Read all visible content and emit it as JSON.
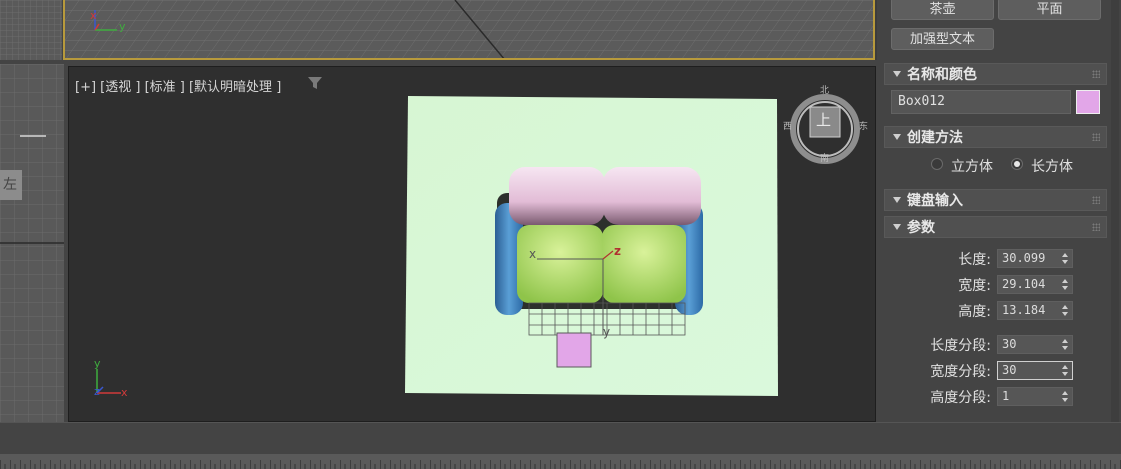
{
  "top_viewport": {
    "axis_labels": {
      "x": "x",
      "y": "y",
      "z": "z"
    }
  },
  "left_viewport": {
    "label": "左"
  },
  "main_viewport": {
    "label": "[+] [透视 ] [标准 ] [默认明暗处理 ]",
    "filter_icon": "funnel-icon",
    "view_cube": {
      "top_face": "上",
      "north": "北",
      "south": "南",
      "east": "东",
      "west": "西"
    },
    "gizmo_labels": {
      "x": "x",
      "y": "y",
      "z": "z"
    },
    "axis_colors": {
      "x": "#d03a3a",
      "y": "#3fae3f",
      "z": "#3a58d0"
    }
  },
  "panel": {
    "buttons": {
      "teapot": "茶壶",
      "plane": "平面",
      "textplus": "加强型文本"
    },
    "rollouts": {
      "name_color": "名称和颜色",
      "creation_method": "创建方法",
      "keyboard_entry": "键盘输入",
      "parameters": "参数"
    },
    "object_name": "Box012",
    "object_color": "#e2a6e8",
    "creation": {
      "cube_label": "立方体",
      "box_label": "长方体",
      "selected": "长方体"
    },
    "params": {
      "length_label": "长度:",
      "length": "30.099",
      "width_label": "宽度:",
      "width": "29.104",
      "height_label": "高度:",
      "height": "13.184",
      "length_segs_label": "长度分段:",
      "length_segs": "30",
      "width_segs_label": "宽度分段:",
      "width_segs": "30",
      "height_segs_label": "高度分段:",
      "height_segs": "1"
    }
  },
  "colors": {
    "selection_border": "#b89a3c",
    "view_plane": "#d9f8d6"
  }
}
